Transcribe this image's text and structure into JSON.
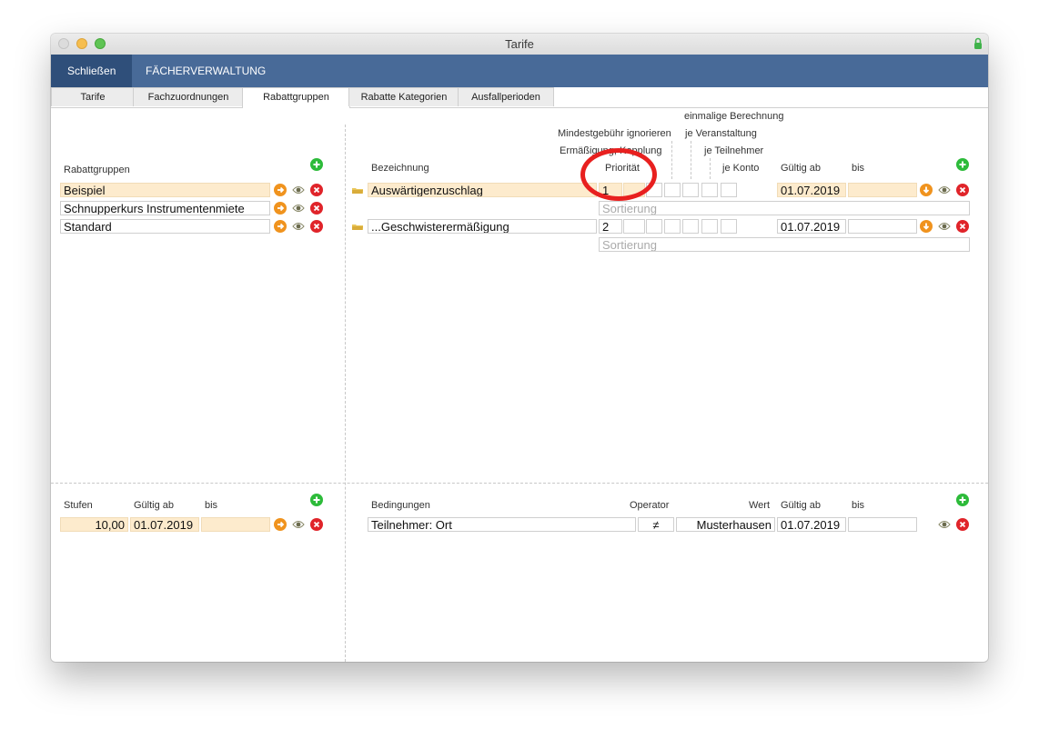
{
  "window": {
    "title": "Tarife"
  },
  "toolbar": {
    "close_label": "Schließen",
    "subjects_label": "FÄCHERVERWALTUNG"
  },
  "tabs": [
    "Tarife",
    "Fachzuordnungen",
    "Rabattgruppen",
    "Rabatte Kategorien",
    "Ausfallperioden"
  ],
  "left": {
    "header": "Rabattgruppen",
    "groups": [
      "Beispiel",
      "Schnupperkurs Instrumentenmiete",
      "Standard"
    ]
  },
  "right": {
    "headers": {
      "bezeichnung": "Bezeichnung",
      "prioritaet": "Priorität",
      "ermaessigung": "Ermäßigung, Kopplung",
      "mindestgebuehr": "Mindestgebühr ignorieren",
      "einmalige": "einmalige Berechnung",
      "veranstaltung": "je Veranstaltung",
      "teilnehmer": "je Teilnehmer",
      "konto": "je Konto",
      "gueltig_ab": "Gültig ab",
      "bis": "bis"
    },
    "rows": [
      {
        "name": "Auswärtigenzuschlag",
        "priority": "1",
        "valid_from": "01.07.2019",
        "valid_to": "",
        "sort_placeholder": "Sortierung"
      },
      {
        "name": "...Geschwisterermäßigung",
        "priority": "2",
        "valid_from": "01.07.2019",
        "valid_to": "",
        "sort_placeholder": "Sortierung"
      }
    ]
  },
  "stufen": {
    "headers": {
      "stufen": "Stufen",
      "gueltig_ab": "Gültig ab",
      "bis": "bis"
    },
    "row": {
      "value": "10,00",
      "valid_from": "01.07.2019",
      "valid_to": ""
    }
  },
  "bedingungen": {
    "headers": {
      "bedingungen": "Bedingungen",
      "operator": "Operator",
      "wert": "Wert",
      "gueltig_ab": "Gültig ab",
      "bis": "bis"
    },
    "row": {
      "condition": "Teilnehmer: Ort",
      "operator": "≠",
      "value": "Musterhausen",
      "valid_from": "01.07.2019",
      "valid_to": ""
    }
  },
  "colors": {
    "toolbar": "#486a98",
    "highlight": "#fdebcd",
    "accent_orange": "#f0931e",
    "delete_red": "#e0242a",
    "add_green": "#2dbb3a",
    "annotation_red": "#e8201f"
  }
}
